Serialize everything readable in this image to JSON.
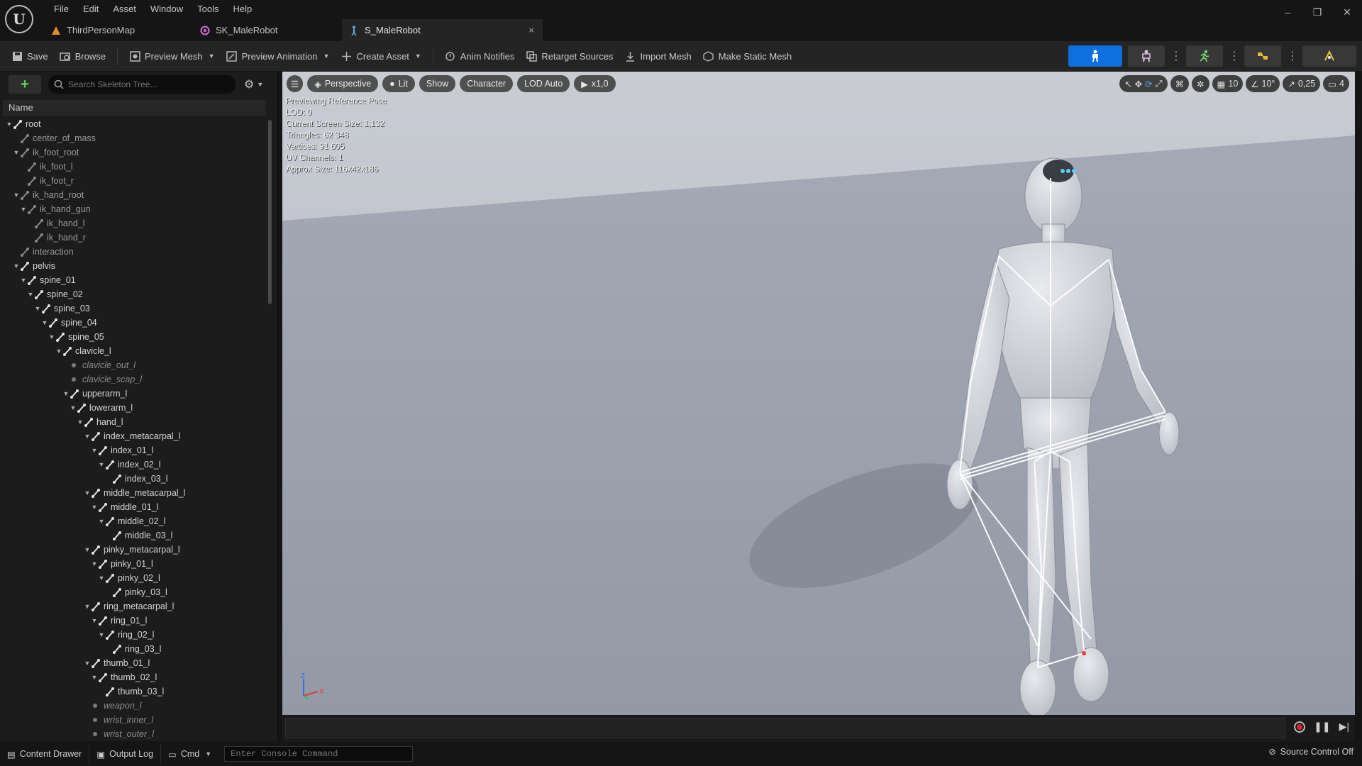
{
  "menu": [
    "File",
    "Edit",
    "Asset",
    "Window",
    "Tools",
    "Help"
  ],
  "tabs": [
    {
      "label": "ThirdPersonMap",
      "icon": "map-icon"
    },
    {
      "label": "SK_MaleRobot",
      "icon": "skeletal-mesh-icon"
    },
    {
      "label": "S_MaleRobot",
      "icon": "skeleton-icon",
      "close": "×"
    }
  ],
  "window_controls": {
    "minimize": "–",
    "restore": "❐",
    "close": "✕"
  },
  "toolbar": {
    "save": "Save",
    "browse": "Browse",
    "preview_mesh": "Preview Mesh",
    "preview_animation": "Preview Animation",
    "create_asset": "Create Asset",
    "anim_notifies": "Anim Notifies",
    "retarget_sources": "Retarget Sources",
    "import_mesh": "Import Mesh",
    "make_static_mesh": "Make Static Mesh"
  },
  "skeleton_tree": {
    "search_placeholder": "Search Skeleton Tree...",
    "column_name": "Name",
    "rows": [
      {
        "label": "root",
        "depth": 0,
        "arrow": true,
        "kind": "bone"
      },
      {
        "label": "center_of_mass",
        "depth": 1,
        "arrow": false,
        "kind": "dim"
      },
      {
        "label": "ik_foot_root",
        "depth": 1,
        "arrow": true,
        "kind": "dim"
      },
      {
        "label": "ik_foot_l",
        "depth": 2,
        "arrow": false,
        "kind": "dim"
      },
      {
        "label": "ik_foot_r",
        "depth": 2,
        "arrow": false,
        "kind": "dim"
      },
      {
        "label": "ik_hand_root",
        "depth": 1,
        "arrow": true,
        "kind": "dim"
      },
      {
        "label": "ik_hand_gun",
        "depth": 2,
        "arrow": true,
        "kind": "dim"
      },
      {
        "label": "ik_hand_l",
        "depth": 3,
        "arrow": false,
        "kind": "dim"
      },
      {
        "label": "ik_hand_r",
        "depth": 3,
        "arrow": false,
        "kind": "dim"
      },
      {
        "label": "interaction",
        "depth": 1,
        "arrow": false,
        "kind": "dim"
      },
      {
        "label": "pelvis",
        "depth": 1,
        "arrow": true,
        "kind": "bone"
      },
      {
        "label": "spine_01",
        "depth": 2,
        "arrow": true,
        "kind": "bone"
      },
      {
        "label": "spine_02",
        "depth": 3,
        "arrow": true,
        "kind": "bone"
      },
      {
        "label": "spine_03",
        "depth": 4,
        "arrow": true,
        "kind": "bone"
      },
      {
        "label": "spine_04",
        "depth": 5,
        "arrow": true,
        "kind": "bone"
      },
      {
        "label": "spine_05",
        "depth": 6,
        "arrow": true,
        "kind": "bone"
      },
      {
        "label": "clavicle_l",
        "depth": 7,
        "arrow": true,
        "kind": "bone"
      },
      {
        "label": "clavicle_out_l",
        "depth": 8,
        "arrow": false,
        "kind": "virtual"
      },
      {
        "label": "clavicle_scap_l",
        "depth": 8,
        "arrow": false,
        "kind": "virtual"
      },
      {
        "label": "upperarm_l",
        "depth": 8,
        "arrow": true,
        "kind": "bone"
      },
      {
        "label": "lowerarm_l",
        "depth": 9,
        "arrow": true,
        "kind": "bone"
      },
      {
        "label": "hand_l",
        "depth": 10,
        "arrow": true,
        "kind": "bone"
      },
      {
        "label": "index_metacarpal_l",
        "depth": 11,
        "arrow": true,
        "kind": "bone"
      },
      {
        "label": "index_01_l",
        "depth": 12,
        "arrow": true,
        "kind": "bone"
      },
      {
        "label": "index_02_l",
        "depth": 13,
        "arrow": true,
        "kind": "bone"
      },
      {
        "label": "index_03_l",
        "depth": 14,
        "arrow": false,
        "kind": "bone"
      },
      {
        "label": "middle_metacarpal_l",
        "depth": 11,
        "arrow": true,
        "kind": "bone"
      },
      {
        "label": "middle_01_l",
        "depth": 12,
        "arrow": true,
        "kind": "bone"
      },
      {
        "label": "middle_02_l",
        "depth": 13,
        "arrow": true,
        "kind": "bone"
      },
      {
        "label": "middle_03_l",
        "depth": 14,
        "arrow": false,
        "kind": "bone"
      },
      {
        "label": "pinky_metacarpal_l",
        "depth": 11,
        "arrow": true,
        "kind": "bone"
      },
      {
        "label": "pinky_01_l",
        "depth": 12,
        "arrow": true,
        "kind": "bone"
      },
      {
        "label": "pinky_02_l",
        "depth": 13,
        "arrow": true,
        "kind": "bone"
      },
      {
        "label": "pinky_03_l",
        "depth": 14,
        "arrow": false,
        "kind": "bone"
      },
      {
        "label": "ring_metacarpal_l",
        "depth": 11,
        "arrow": true,
        "kind": "bone"
      },
      {
        "label": "ring_01_l",
        "depth": 12,
        "arrow": true,
        "kind": "bone"
      },
      {
        "label": "ring_02_l",
        "depth": 13,
        "arrow": true,
        "kind": "bone"
      },
      {
        "label": "ring_03_l",
        "depth": 14,
        "arrow": false,
        "kind": "bone"
      },
      {
        "label": "thumb_01_l",
        "depth": 11,
        "arrow": true,
        "kind": "bone"
      },
      {
        "label": "thumb_02_l",
        "depth": 12,
        "arrow": true,
        "kind": "bone"
      },
      {
        "label": "thumb_03_l",
        "depth": 13,
        "arrow": false,
        "kind": "bone"
      },
      {
        "label": "weapon_l",
        "depth": 11,
        "arrow": false,
        "kind": "virtual"
      },
      {
        "label": "wrist_inner_l",
        "depth": 11,
        "arrow": false,
        "kind": "virtual"
      },
      {
        "label": "wrist_outer_l",
        "depth": 11,
        "arrow": false,
        "kind": "virtual"
      }
    ]
  },
  "viewport": {
    "perspective": "Perspective",
    "lit": "Lit",
    "show": "Show",
    "character": "Character",
    "lod": "LOD Auto",
    "speed": "x1,0",
    "grid_snap": "10",
    "rotation_snap": "10°",
    "scale_snap": "0,25",
    "camera_speed": "4",
    "stats": [
      "Previewing Reference Pose",
      "LOD: 0",
      "Current Screen Size: 1,132",
      "Triangles: 62 348",
      "Vertices: 91 605",
      "UV Channels: 1",
      "Approx Size: 116x42x186"
    ],
    "axis_z": "Z",
    "axis_x": "X"
  },
  "status": {
    "content_drawer": "Content Drawer",
    "output_log": "Output Log",
    "cmd": "Cmd",
    "console_placeholder": "Enter Console Command",
    "source_control": "Source Control Off"
  },
  "colors": {
    "accent": "#0f6fde",
    "viewport_bg": "#9aa0ad",
    "add_green": "#5cd25c",
    "record_red": "#dd2233"
  }
}
